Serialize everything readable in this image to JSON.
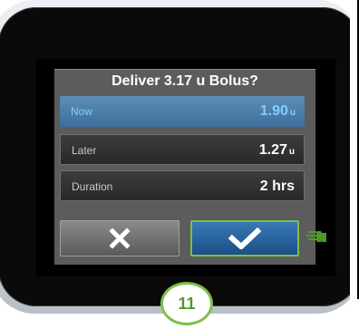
{
  "dialog": {
    "title": "Deliver 3.17 u Bolus?",
    "rows": [
      {
        "label": "Now",
        "value": "1.90",
        "unit": "u"
      },
      {
        "label": "Later",
        "value": "1.27",
        "unit": "u"
      },
      {
        "label": "Duration",
        "value": "2 hrs",
        "unit": ""
      }
    ]
  },
  "buttons": {
    "cancel": "cancel-x-icon",
    "confirm": "checkmark-icon"
  },
  "pointer_icon": "tap-hand-icon",
  "step_badge": "11",
  "colors": {
    "accent_blue": "#3a79b5",
    "now_text": "#7fd0ff",
    "green": "#7cc04a"
  }
}
